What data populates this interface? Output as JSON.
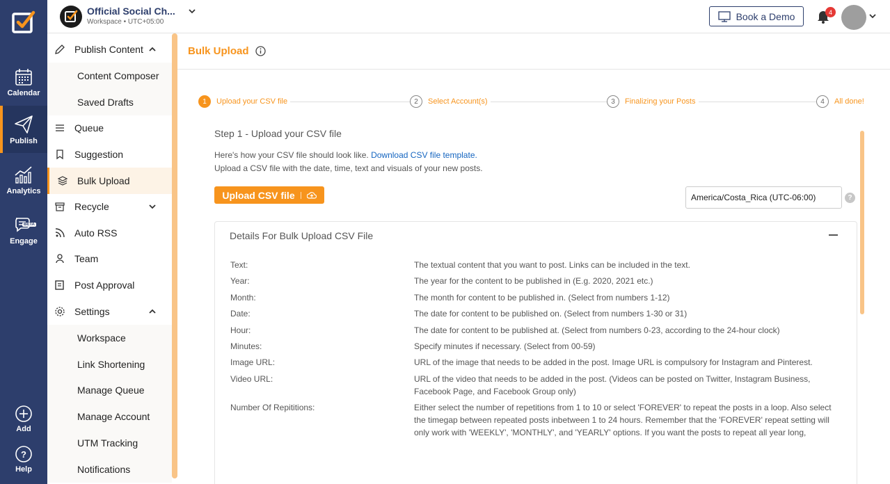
{
  "rail": {
    "items": [
      {
        "label": "Calendar",
        "icon": "calendar-icon"
      },
      {
        "label": "Publish",
        "icon": "paper-plane-icon"
      },
      {
        "label": "Analytics",
        "icon": "analytics-icon"
      },
      {
        "label": "Engage",
        "icon": "chat-icon",
        "badge": "BETA"
      },
      {
        "label": "Add",
        "icon": "plus-circle-icon"
      },
      {
        "label": "Help",
        "icon": "help-circle-icon"
      }
    ],
    "accent": "#f7941d",
    "background": "#2d3e6c"
  },
  "header": {
    "workspace_name": "Official Social Ch...",
    "workspace_sub": "Workspace • UTC+05:00",
    "book_demo": "Book a Demo",
    "notification_count": "4"
  },
  "sidebar": {
    "publish_content": "Publish Content",
    "content_composer": "Content Composer",
    "saved_drafts": "Saved Drafts",
    "queue": "Queue",
    "suggestion": "Suggestion",
    "bulk_upload": "Bulk Upload",
    "recycle": "Recycle",
    "auto_rss": "Auto RSS",
    "team": "Team",
    "post_approval": "Post Approval",
    "settings": "Settings",
    "workspace": "Workspace",
    "link_shortening": "Link Shortening",
    "manage_queue": "Manage Queue",
    "manage_account": "Manage Account",
    "utm_tracking": "UTM Tracking",
    "notifications": "Notifications"
  },
  "main": {
    "title": "Bulk Upload",
    "steps": [
      {
        "num": "1",
        "label": "Upload your CSV file"
      },
      {
        "num": "2",
        "label": "Select Account(s)"
      },
      {
        "num": "3",
        "label": "Finalizing your Posts"
      },
      {
        "num": "4",
        "label": "All done!"
      }
    ],
    "step_heading": "Step 1 - Upload your CSV file",
    "help_prefix": "Here's how your CSV file should look like.",
    "help_link": "Download CSV file template.",
    "help_line2": "Upload a CSV file with the date, time, text and visuals of your new posts.",
    "upload_button": "Upload CSV file",
    "timezone": "America/Costa_Rica (UTC-06:00)",
    "timezone_help": "?",
    "details_title": "Details For Bulk Upload CSV File",
    "fields": [
      {
        "label": "Text:",
        "desc": "The textual content that you want to post. Links can be included in the text."
      },
      {
        "label": "Year:",
        "desc": "The year for the content to be published in (E.g. 2020, 2021 etc.)"
      },
      {
        "label": "Month:",
        "desc": "The month for content to be published in. (Select from numbers 1-12)"
      },
      {
        "label": "Date:",
        "desc": "The date for content to be published on. (Select from numbers 1-30 or 31)"
      },
      {
        "label": "Hour:",
        "desc": "The date for content to be published at. (Select from numbers 0-23, according to the 24-hour clock)"
      },
      {
        "label": "Minutes:",
        "desc": "Specify minutes if necessary. (Select from 00-59)"
      },
      {
        "label": "Image URL:",
        "desc": "URL of the image that needs to be added in the post. Image URL is compulsory for Instagram and Pinterest."
      },
      {
        "label": "Video URL:",
        "desc": "URL of the video that needs to be added in the post. (Videos can be posted on Twitter, Instagram Business, Facebook Page, and Facebook Group only)"
      },
      {
        "label": "Number Of Repititions:",
        "desc": "Either select the number of repetitions from 1 to 10 or select 'FOREVER' to repeat the posts in a loop. Also select the timegap between repeated posts inbetween 1 to 24 hours. Remember that the 'FOREVER' repeat setting will only work with 'WEEKLY', 'MONTHLY', and 'YEARLY' options. If you want the posts to repeat all year long,"
      }
    ]
  }
}
